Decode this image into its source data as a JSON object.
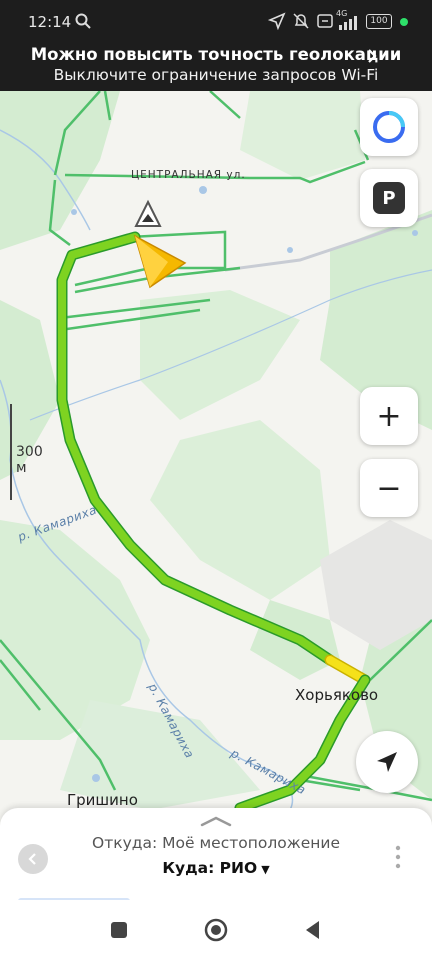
{
  "status_bar": {
    "time": "12:14",
    "network": "4G",
    "battery": "100"
  },
  "banner": {
    "line1": "Можно повысить точность геолокации",
    "line2": "Выключите ограничение запросов Wi-Fi"
  },
  "map": {
    "street_label": "ЦЕНТРАЛЬНАЯ ул.",
    "places": [
      "Хорьяково",
      "Гришино"
    ],
    "rivers": [
      "р. Камариха",
      "р. Камариха",
      "р. Камариха"
    ],
    "scale_label": "300 м",
    "route_color": "#7ed321",
    "route_jam_color": "#f5e11a",
    "cursor_color": "#f5b800"
  },
  "controls": {
    "parking_label": "P",
    "zoom_in": "+",
    "zoom_out": "−"
  },
  "route_card": {
    "from_text": "Откуда: Моё местоположение",
    "to_text": "Куда: РИО",
    "to_caret": "▼"
  }
}
